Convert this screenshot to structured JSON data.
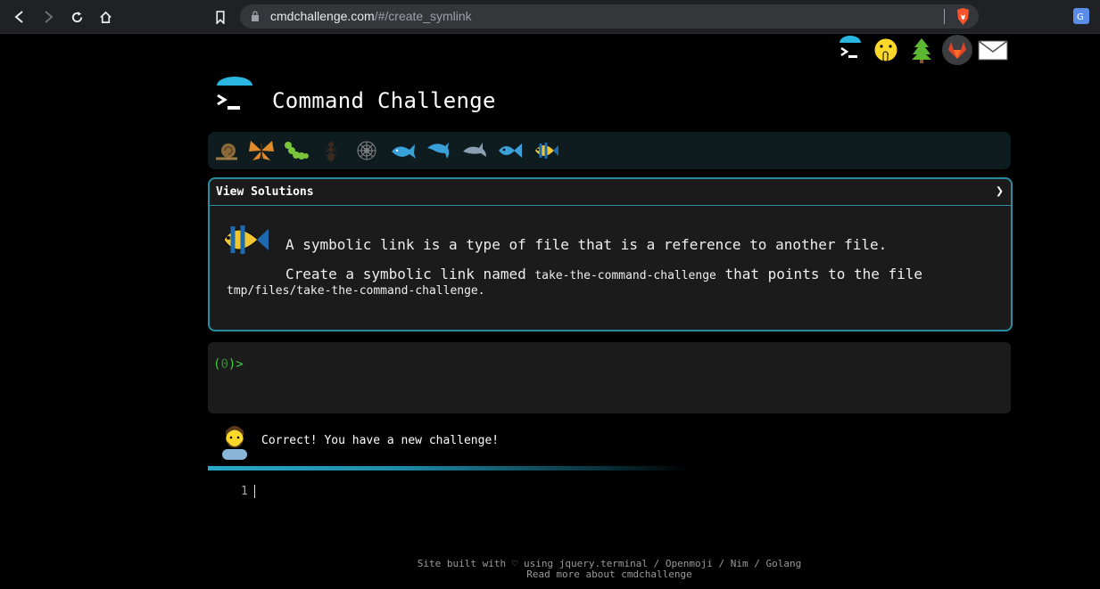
{
  "browser": {
    "url_host": "cmdchallenge.com",
    "url_path": "/#/create_symlink",
    "nav_icons": [
      "back-icon",
      "forward-icon",
      "reload-icon",
      "home-icon",
      "bookmark-icon"
    ]
  },
  "topbar": {
    "icons": [
      "terminal-logo-icon",
      "shushing-face-icon",
      "evergreen-tree-icon",
      "gitlab-icon",
      "envelope-icon"
    ]
  },
  "header": {
    "title": "Command Challenge"
  },
  "levels": {
    "icons": [
      "snail-icon",
      "butterfly-icon",
      "caterpillar-icon",
      "ant-icon",
      "spider-web-icon",
      "whale-icon",
      "dolphin-icon",
      "dolphin-icon",
      "fish-icon",
      "tropical-fish-icon"
    ]
  },
  "challenge": {
    "header_label": "View Solutions",
    "chevron": "❯",
    "line1": "A symbolic link is a type of file that is a reference to another file.",
    "line2_prefix": "Create a symbolic link named ",
    "line2_code": "take-the-command-challenge",
    "line2_suffix": " that points to the file",
    "line3_code": "tmp/files/take-the-command-challenge",
    "line3_suffix": "."
  },
  "terminal": {
    "prompt_open": "(",
    "prompt_count": "0",
    "prompt_close": ")>"
  },
  "feedback": {
    "message": "Correct! You have a new challenge!"
  },
  "editor": {
    "line_number": "1"
  },
  "footer": {
    "line1": "Site built with ♡ using jquery.terminal / Openmoji / Nim / Golang",
    "line2": "Read more about cmdchallenge"
  },
  "colors": {
    "accent": "#2a8ca0",
    "prompt": "#3fcf3f",
    "background": "#000000"
  }
}
